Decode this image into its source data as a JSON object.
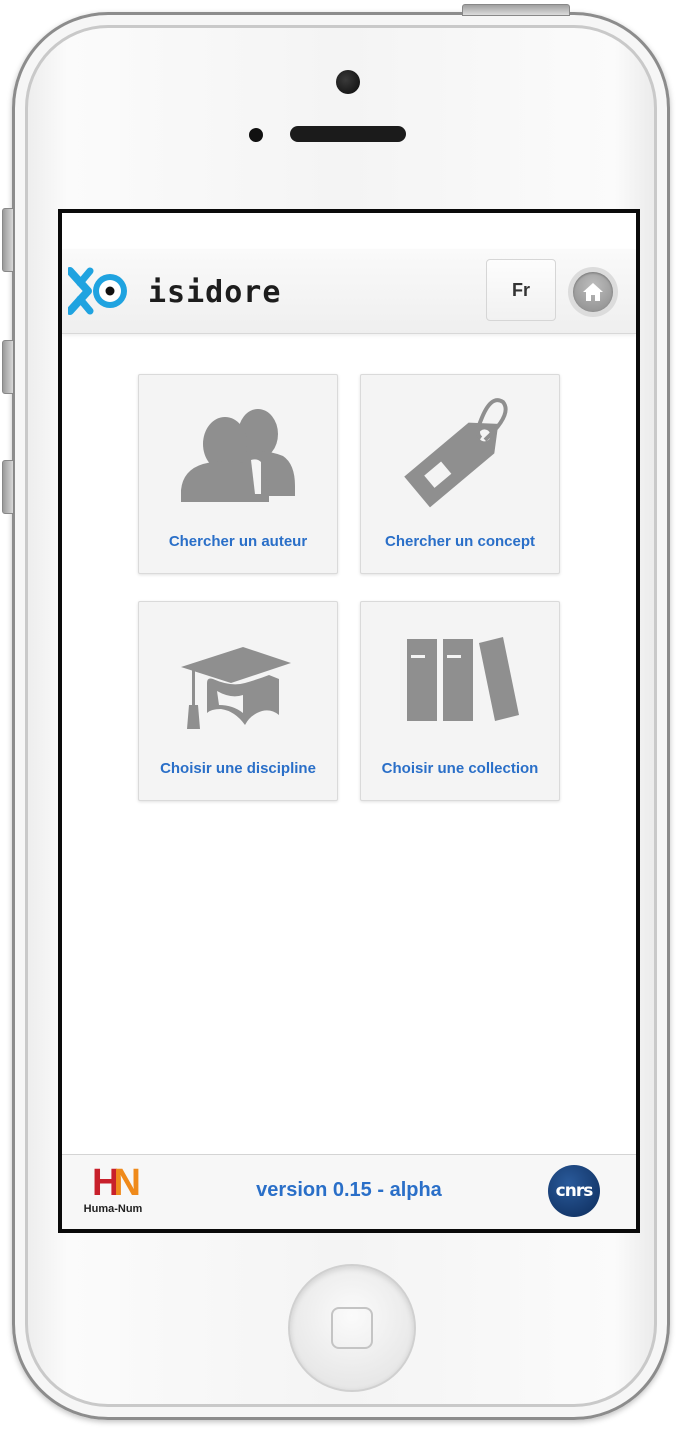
{
  "app": {
    "logo_text": "isidore",
    "brand_color": "#1fa3e0"
  },
  "header": {
    "language_label": "Fr",
    "home_icon": "home-icon"
  },
  "tiles": [
    {
      "label": "Chercher un auteur",
      "icon": "users-icon"
    },
    {
      "label": "Chercher un concept",
      "icon": "tag-icon"
    },
    {
      "label": "Choisir une discipline",
      "icon": "graduation-cap-icon"
    },
    {
      "label": "Choisir une collection",
      "icon": "books-icon"
    }
  ],
  "footer": {
    "left_logo": {
      "mark_h": "H",
      "mark_n": "N",
      "text": "Huma-Num"
    },
    "version": "version 0.15 - alpha",
    "right_logo": {
      "text": "cnrs"
    }
  },
  "colors": {
    "link": "#2a6fc8",
    "icon_gray": "#8f8f8f"
  }
}
